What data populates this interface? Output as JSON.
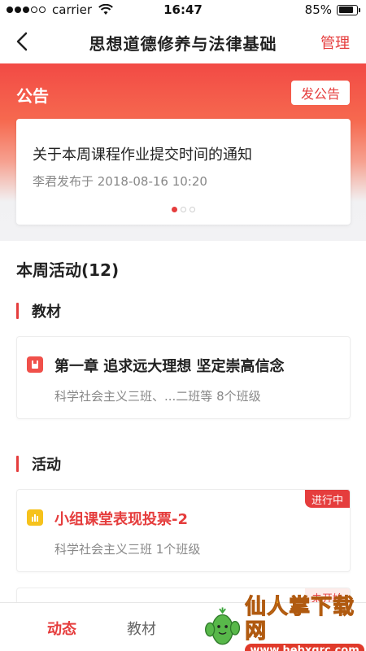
{
  "status_bar": {
    "carrier": "carrier",
    "time": "16:47",
    "battery": "85%",
    "battery_level": 0.85
  },
  "nav": {
    "title": "思想道德修养与法律基础",
    "manage_label": "管理"
  },
  "notice": {
    "title": "公告",
    "post_button": "发公告",
    "headline": "关于本周课程作业提交时间的通知",
    "meta": "李君发布于 2018-08-16 10:20",
    "page_count": 3,
    "active_page": 0
  },
  "weekly": {
    "heading": "本周活动(12)",
    "sections": [
      {
        "label": "教材",
        "cards": [
          {
            "title": "第一章 追求远大理想 坚定崇高信念",
            "subtitle": "科学社会主义三班、...二班等 8个班级",
            "icon": "book-icon",
            "icon_color": "#f0504a"
          }
        ]
      },
      {
        "label": "活动",
        "cards": [
          {
            "title": "小组课堂表现投票-2",
            "subtitle": "科学社会主义三班 1个班级",
            "icon": "bar-chart-icon",
            "icon_color": "#f6c21c",
            "badge": "进行中"
          },
          {
            "title": "",
            "subtitle": "",
            "badge": "未开始"
          }
        ]
      }
    ]
  },
  "tabs": [
    {
      "label": "动态",
      "active": true
    },
    {
      "label": "教材",
      "active": false
    }
  ],
  "watermark": {
    "cn": "仙人掌下载网",
    "url": "www.hebxqrc.com"
  },
  "colors": {
    "accent": "#e53d3d",
    "badge_active_bg": "#e53d3d",
    "badge_pending_bg": "#fdecea"
  }
}
